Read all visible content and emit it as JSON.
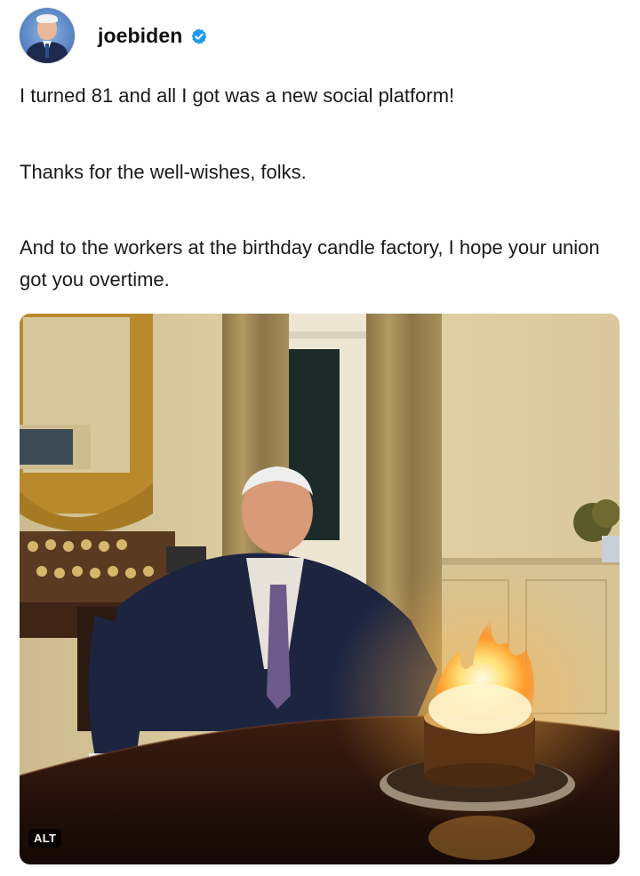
{
  "post": {
    "username": "joebiden",
    "verified": true,
    "avatar_icon": "profile-photo",
    "text": {
      "line1": "I turned 81 and all I got was a new social platform!",
      "line2": "Thanks for the well-wishes, folks.",
      "line3": "And to the workers at the birthday candle factory, I hope your union got you overtime."
    },
    "media": {
      "badge": "ALT"
    }
  },
  "colors": {
    "verified_blue": "#1d9bf0",
    "text": "#1a1a1a",
    "background": "#ffffff"
  }
}
